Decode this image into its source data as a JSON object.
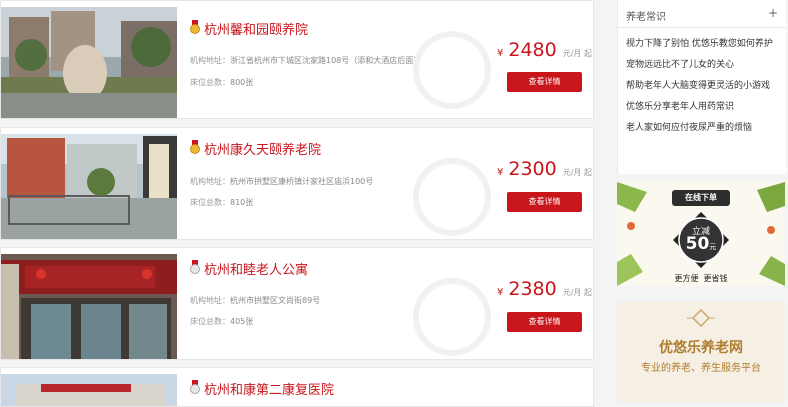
{
  "listings": [
    {
      "name": "杭州馨和园颐养院",
      "medal": "gold",
      "address_label": "机构地址：",
      "address": "浙江省杭州市下城区沈家路108号（添和大酒店后面）",
      "beds_label": "床位总数：",
      "beds": "800张",
      "currency": "¥",
      "price": "2480",
      "unit": "元/月 起",
      "cta": "查看详情"
    },
    {
      "name": "杭州康久天颐养老院",
      "medal": "gold",
      "address_label": "机构地址：",
      "address": "杭州市拱墅区康桥镇计家社区庙浜100号",
      "beds_label": "床位总数：",
      "beds": "810张",
      "currency": "¥",
      "price": "2300",
      "unit": "元/月 起",
      "cta": "查看详情"
    },
    {
      "name": "杭州和睦老人公寓",
      "medal": "silver",
      "address_label": "机构地址：",
      "address": "杭州市拱墅区文尚街89号",
      "beds_label": "床位总数：",
      "beds": "405张",
      "currency": "¥",
      "price": "2380",
      "unit": "元/月 起",
      "cta": "查看详情"
    },
    {
      "name": "杭州和康第二康复医院",
      "medal": "silver",
      "currency": "¥"
    }
  ],
  "knowledge": {
    "title": "养老常识",
    "expand": "+",
    "items": [
      "视力下降了别怕 优悠乐教您如何养护",
      "宠物远远比不了儿女的关心",
      "帮助老年人大脑变得更灵活的小游戏",
      "优悠乐分享老年人用药常识",
      "老人家如何应付夜尿严重的烦恼"
    ]
  },
  "promo": {
    "badge": "在线下单",
    "deal": "立减",
    "amount": "50",
    "amount_unit": "元",
    "slogan": "更方便  更省钱"
  },
  "ad": {
    "brand": "优悠乐养老网",
    "tagline": "专业的养老、养生服务平台"
  }
}
